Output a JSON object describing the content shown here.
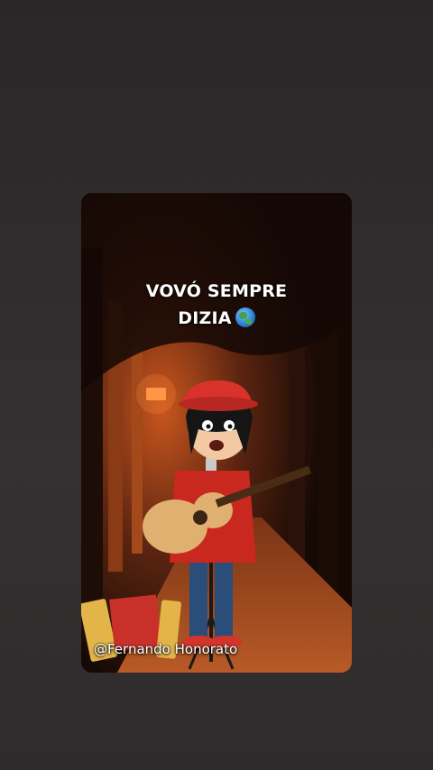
{
  "story": {
    "caption_line1": "VOVÓ SEMPRE",
    "caption_line2": "DIZIA",
    "caption_emoji": "globe-icon",
    "watermark": "@Fernando Honorato"
  },
  "colors": {
    "background": "#302c2d",
    "caption_text": "#ffffff",
    "hat": "#d8322a",
    "jacket": "#c8281e",
    "guitar": "#e0b070"
  }
}
